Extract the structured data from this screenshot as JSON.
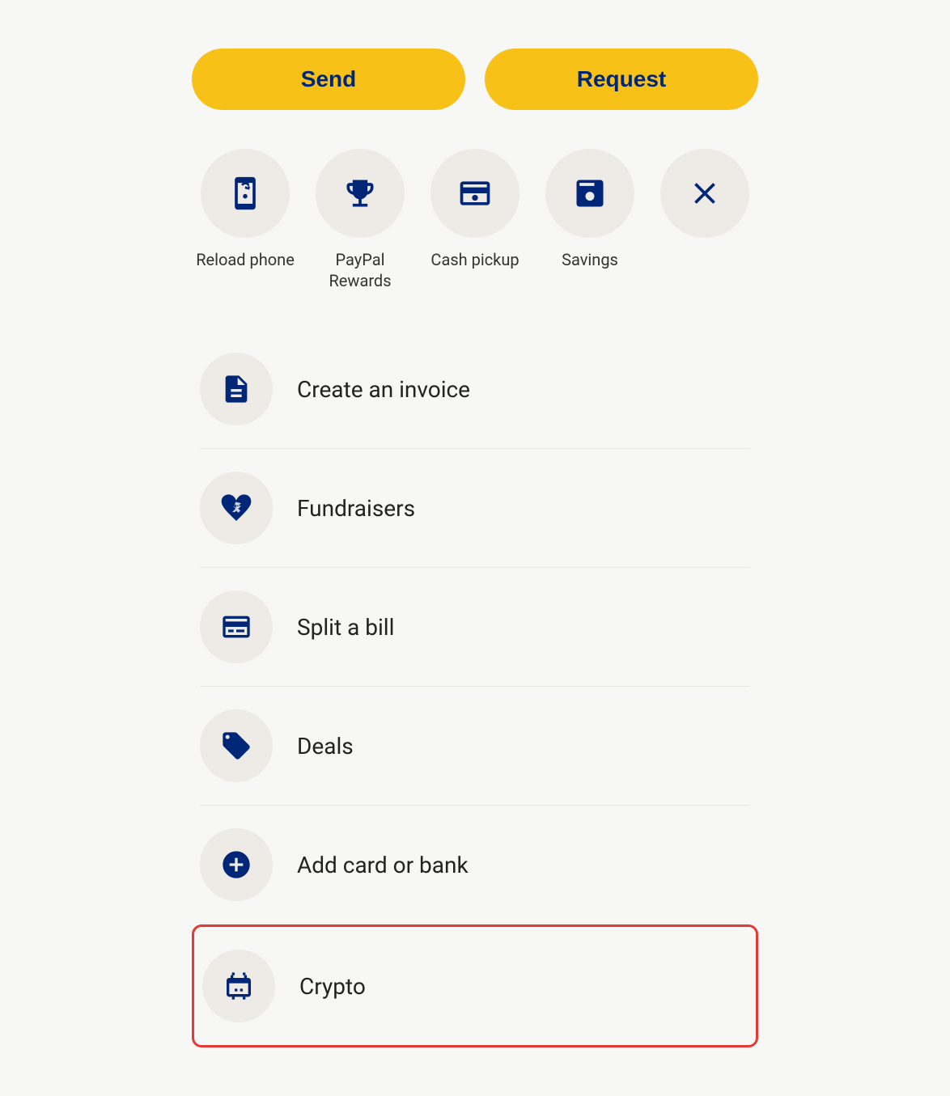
{
  "buttons": {
    "send": "Send",
    "request": "Request"
  },
  "iconGrid": [
    {
      "id": "reload-phone",
      "label": "Reload phone",
      "icon": "phone-reload"
    },
    {
      "id": "paypal-rewards",
      "label": "PayPal Rewards",
      "icon": "trophy"
    },
    {
      "id": "cash-pickup",
      "label": "Cash pickup",
      "icon": "cash-pickup"
    },
    {
      "id": "savings",
      "label": "Savings",
      "icon": "savings"
    },
    {
      "id": "close",
      "label": "",
      "icon": "close"
    }
  ],
  "listItems": [
    {
      "id": "create-invoice",
      "label": "Create an invoice",
      "icon": "invoice",
      "highlighted": false
    },
    {
      "id": "fundraisers",
      "label": "Fundraisers",
      "icon": "fundraisers",
      "highlighted": false
    },
    {
      "id": "split-bill",
      "label": "Split a bill",
      "icon": "split-bill",
      "highlighted": false
    },
    {
      "id": "deals",
      "label": "Deals",
      "icon": "deals",
      "highlighted": false
    },
    {
      "id": "add-card-bank",
      "label": "Add card or bank",
      "icon": "add-card",
      "highlighted": false
    },
    {
      "id": "crypto",
      "label": "Crypto",
      "icon": "crypto",
      "highlighted": true
    }
  ],
  "colors": {
    "brand": "#002677",
    "accent": "#f8c118",
    "background": "#f7f7f5",
    "iconBg": "#eeebe6",
    "highlight": "#e53935"
  }
}
